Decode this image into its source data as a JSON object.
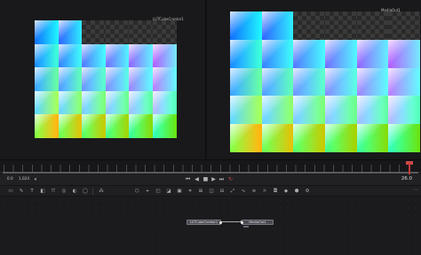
{
  "viewers": {
    "left": {
      "label": "LUTCubeCreator1"
    },
    "right": {
      "label": "MediaOut1"
    }
  },
  "transport": {
    "render_start": "0.0",
    "render_end": "1,024",
    "frame": "26.0"
  },
  "nodes": {
    "loader": "LUTCubeCreator1",
    "media_out": "MediaOut1"
  },
  "colors": {
    "playhead": "#c23a3a",
    "node_fill": "#4b4b52",
    "background": "#1b1b1d"
  },
  "icons": {
    "transport": [
      "audio-icon",
      "first-frame-icon",
      "prev-frame-icon",
      "stop-icon",
      "play-icon",
      "next-frame-icon",
      "last-frame-icon",
      "loop-icon"
    ],
    "toolbar": [
      "background-icon",
      "paint-icon",
      "text-icon",
      "merge-icon",
      "transform-icon",
      "blur-icon",
      "color-icon",
      "mask-icon",
      "particles-icon",
      "3d-icon",
      "tracker-icon",
      "settings-icon",
      "more-icon"
    ]
  }
}
